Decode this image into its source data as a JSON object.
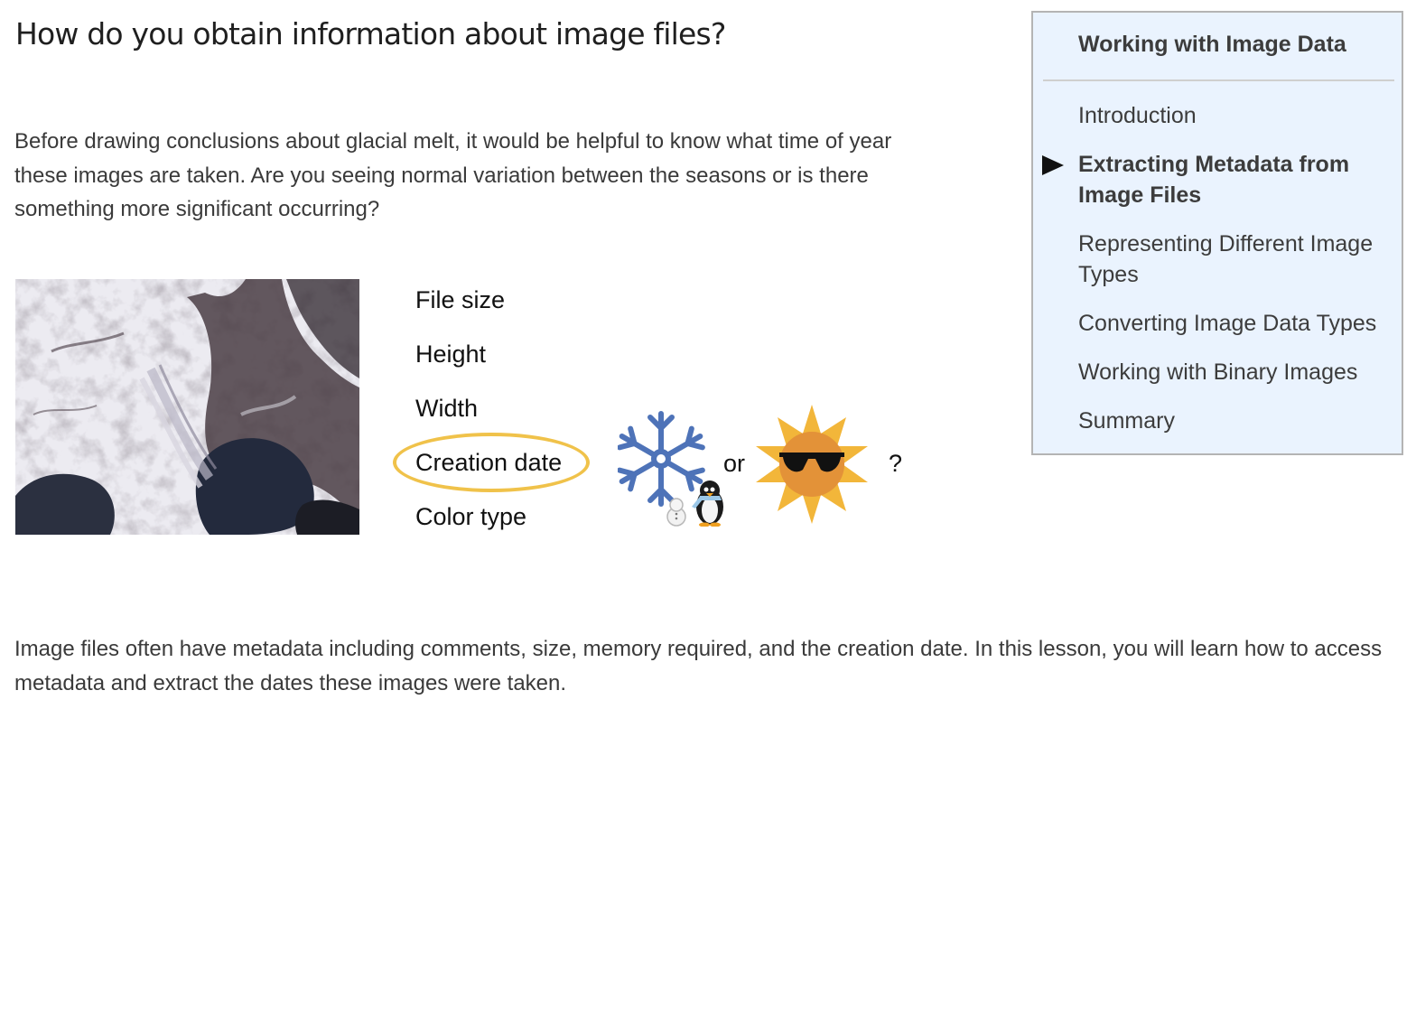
{
  "page": {
    "title": "How do you obtain information about image files?",
    "intro": "Before drawing conclusions about glacial melt, it would be helpful to know what time of year these images are taken. Are you seeing normal variation between the seasons or is there something more significant occurring?",
    "outro": "Image files often have metadata including comments, size, memory required, and the creation date. In this lesson, you will learn how to access metadata and extract the dates these images were taken."
  },
  "figure": {
    "metadata_items": [
      "File size",
      "Height",
      "Width",
      "Creation date",
      "Color type"
    ],
    "highlighted_item": "Creation date",
    "or_label": "or",
    "question_mark": "?",
    "icons": [
      "snowflake-icon",
      "snowman-icon",
      "penguin-icon",
      "sun-with-sunglasses-icon"
    ],
    "colors": {
      "highlight": "#f0c24a",
      "snowflake": "#4e73b8",
      "sun": "#f2b63a"
    }
  },
  "toc": {
    "title": "Working with Image Data",
    "items": [
      {
        "label": "Introduction",
        "active": false
      },
      {
        "label": "Extracting Metadata from Image Files",
        "active": true
      },
      {
        "label": "Representing Different Image Types",
        "active": false
      },
      {
        "label": "Converting Image Data Types",
        "active": false
      },
      {
        "label": "Working with Binary Images",
        "active": false
      },
      {
        "label": "Summary",
        "active": false
      }
    ],
    "colors": {
      "background": "#eaf3fe",
      "border": "#b4b4b4"
    }
  }
}
